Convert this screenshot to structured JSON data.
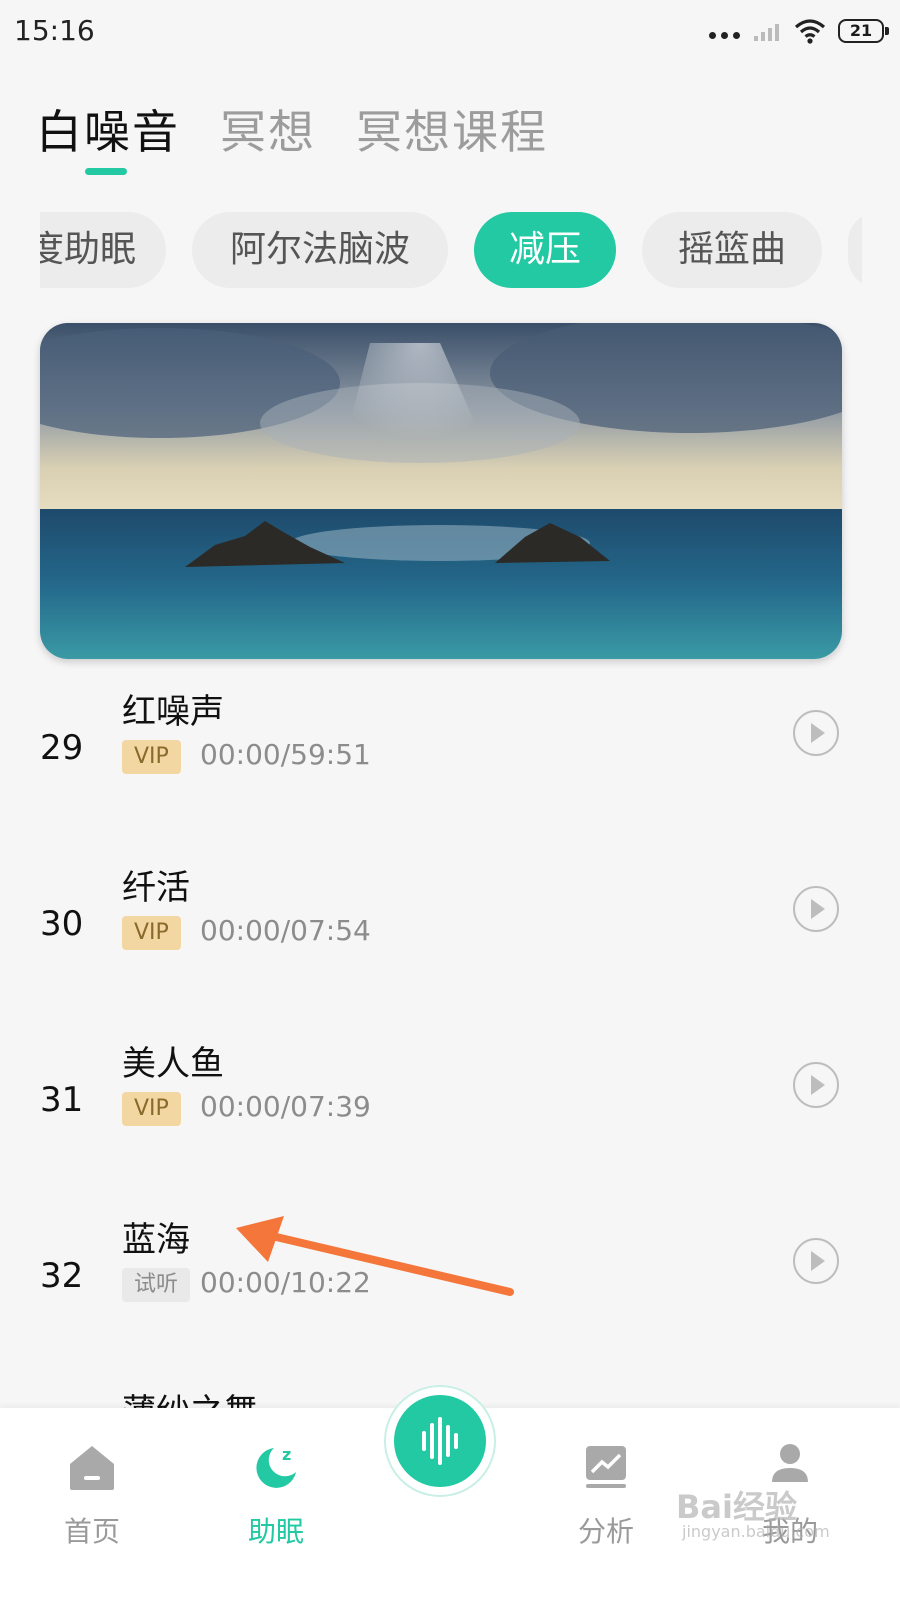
{
  "status_bar": {
    "time": "15:16",
    "battery": "21"
  },
  "top_tabs": [
    {
      "label": "白噪音",
      "active": true
    },
    {
      "label": "冥想",
      "active": false
    },
    {
      "label": "冥想课程",
      "active": false
    }
  ],
  "categories": [
    {
      "label": "度助眠",
      "active": false
    },
    {
      "label": "阿尔法脑波",
      "active": false
    },
    {
      "label": "减压",
      "active": true
    },
    {
      "label": "摇篮曲",
      "active": false
    },
    {
      "label": "",
      "active": false
    }
  ],
  "tracks": [
    {
      "number": "29",
      "title": "红噪声",
      "badge": "VIP",
      "badge_type": "vip",
      "time": "00:00/59:51"
    },
    {
      "number": "30",
      "title": "纤活",
      "badge": "VIP",
      "badge_type": "vip",
      "time": "00:00/07:54"
    },
    {
      "number": "31",
      "title": "美人鱼",
      "badge": "VIP",
      "badge_type": "vip",
      "time": "00:00/07:39"
    },
    {
      "number": "32",
      "title": "蓝海",
      "badge": "试听",
      "badge_type": "trial",
      "time": "00:00/10:22"
    }
  ],
  "partial_track_title": "薄纱之舞",
  "bottom_nav": [
    {
      "label": "首页",
      "icon": "home-icon",
      "active": false
    },
    {
      "label": "助眠",
      "icon": "moon-sleep-icon",
      "active": true
    },
    {
      "label": "",
      "icon": "soundwave-icon",
      "active": false
    },
    {
      "label": "分析",
      "icon": "chart-icon",
      "active": false
    },
    {
      "label": "我的",
      "icon": "person-icon",
      "active": false
    }
  ],
  "watermark": {
    "text": "Bai经验",
    "sub": "jingyan.baidu.com"
  },
  "colors": {
    "accent": "#22c9a3",
    "vip_bg": "#f2d7a2",
    "annotation_arrow": "#f4763a"
  }
}
